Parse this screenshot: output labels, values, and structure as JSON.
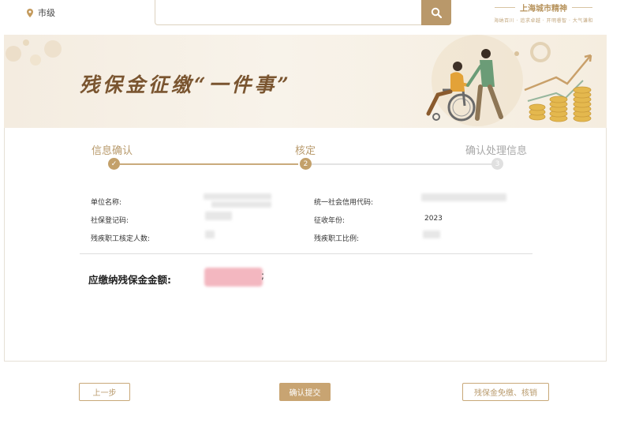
{
  "header": {
    "location_label": "市级",
    "spirit_title": "上海城市精神",
    "spirit_subtitle": "海纳百川 · 追求卓越 · 开明睿智 · 大气谦和"
  },
  "banner": {
    "title": "残保金征缴“一件事”"
  },
  "steps": [
    {
      "label": "信息确认",
      "marker": "✓",
      "state": "done"
    },
    {
      "label": "核定",
      "marker": "2",
      "state": "current"
    },
    {
      "label": "确认处理信息",
      "marker": "3",
      "state": "pending"
    }
  ],
  "form": {
    "unit_name_label": "单位名称:",
    "social_security_no_label": "社保登记码:",
    "disabled_staff_count_label": "残疾职工核定人数:",
    "credit_code_label": "统一社会信用代码:",
    "collection_year_label": "征收年份:",
    "collection_year_value": "2023",
    "disabled_staff_ratio_label": "残疾职工比例:",
    "amount_label": "应缴纳残保金金额:",
    "amount_suffix": ";"
  },
  "buttons": {
    "prev": "上一步",
    "confirm": "确认提交",
    "exempt": "残保金免缴、核销"
  },
  "colors": {
    "accent": "#b89a6c",
    "primary_button": "#c8a472",
    "banner_title": "#7a5530"
  }
}
